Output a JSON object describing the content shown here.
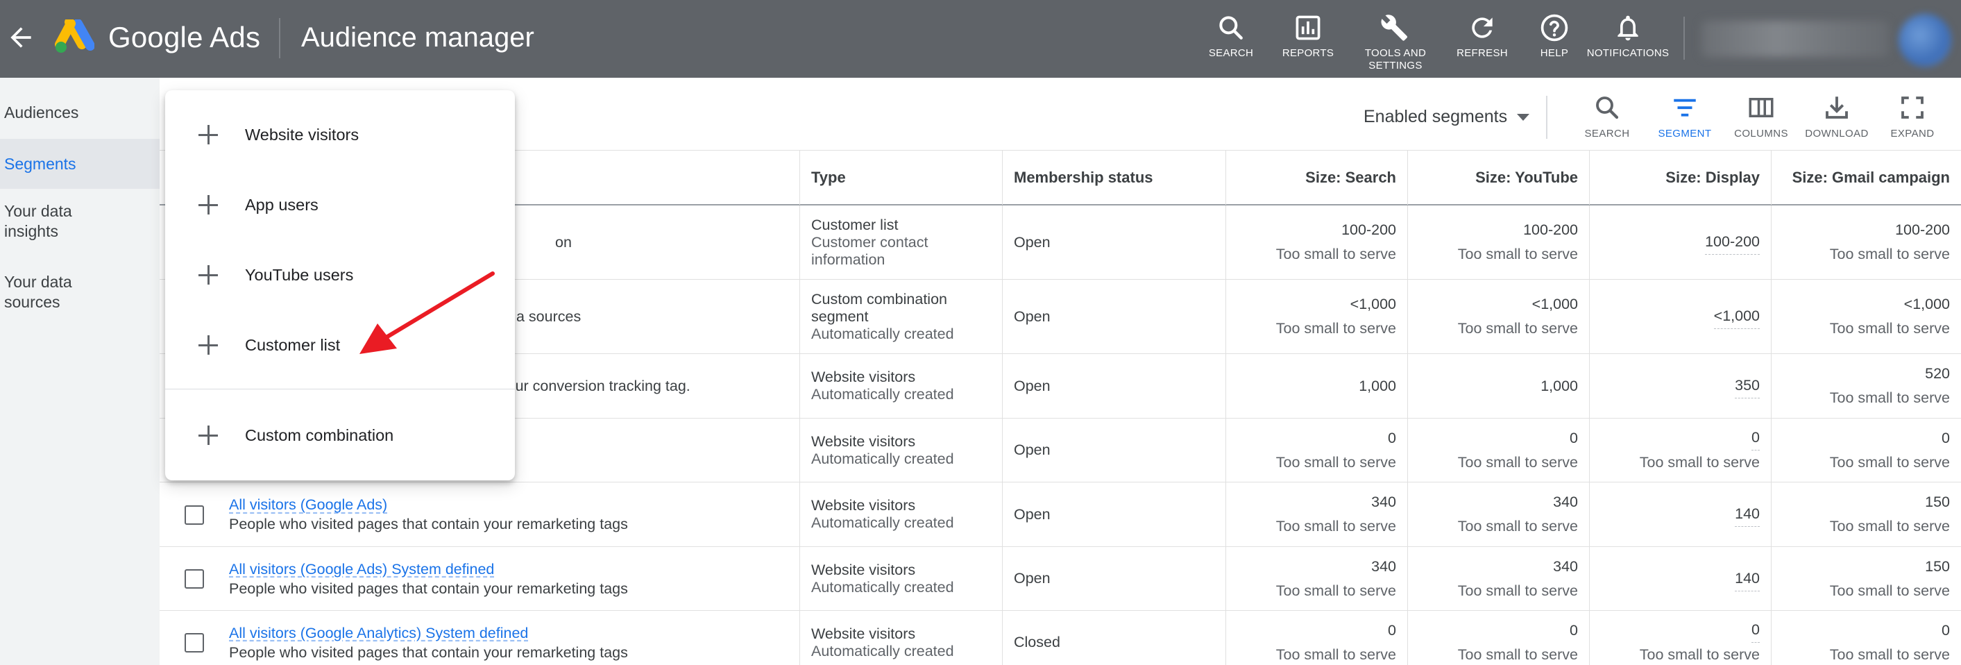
{
  "topbar": {
    "brand": "Google Ads",
    "page_title": "Audience manager",
    "actions": [
      {
        "label": "SEARCH",
        "icon": "search-icon"
      },
      {
        "label": "REPORTS",
        "icon": "reports-icon"
      },
      {
        "label": "TOOLS AND\nSETTINGS",
        "icon": "wrench-icon"
      },
      {
        "label": "REFRESH",
        "icon": "refresh-icon"
      },
      {
        "label": "HELP",
        "icon": "help-icon"
      },
      {
        "label": "NOTIFICATIONS",
        "icon": "bell-icon"
      }
    ]
  },
  "sidebar": {
    "items": [
      {
        "label": "Audiences",
        "active": false
      },
      {
        "label": "Segments",
        "active": true
      },
      {
        "label": "Your data insights",
        "active": false
      },
      {
        "label": "Your data sources",
        "active": false
      }
    ]
  },
  "toolbar": {
    "filter_label": "Enabled segments",
    "tools": [
      {
        "label": "SEARCH",
        "icon": "search-icon"
      },
      {
        "label": "SEGMENT",
        "icon": "segment-icon"
      },
      {
        "label": "COLUMNS",
        "icon": "columns-icon"
      },
      {
        "label": "DOWNLOAD",
        "icon": "download-icon"
      },
      {
        "label": "EXPAND",
        "icon": "expand-icon"
      }
    ]
  },
  "menu": {
    "items": [
      {
        "label": "Website visitors"
      },
      {
        "label": "App users"
      },
      {
        "label": "YouTube users"
      },
      {
        "label": "Customer list"
      },
      {
        "label": "Custom combination"
      }
    ]
  },
  "table": {
    "headers": {
      "type": "Type",
      "membership": "Membership status",
      "size_search": "Size: Search",
      "size_youtube": "Size: YouTube",
      "size_display": "Size: Display",
      "size_gmail": "Size: Gmail campaign"
    },
    "rows": [
      {
        "name": "",
        "desc": "on",
        "type": "Customer list",
        "type_sub": "Customer contact information",
        "membership": "Open",
        "search": {
          "v": "100-200",
          "s": "Too small to serve"
        },
        "youtube": {
          "v": "100-200",
          "s": "Too small to serve"
        },
        "display": {
          "v": "100-200",
          "s": ""
        },
        "gmail": {
          "v": "100-200",
          "s": "Too small to serve"
        }
      },
      {
        "name": "",
        "desc": "a sources",
        "type": "Custom combination segment",
        "type_sub": "Automatically created",
        "membership": "Open",
        "search": {
          "v": "<1,000",
          "s": "Too small to serve"
        },
        "youtube": {
          "v": "<1,000",
          "s": "Too small to serve"
        },
        "display": {
          "v": "<1,000",
          "s": ""
        },
        "gmail": {
          "v": "<1,000",
          "s": "Too small to serve"
        }
      },
      {
        "name": "",
        "desc": "on your conversion tracking tag.",
        "type": "Website visitors",
        "type_sub": "Automatically created",
        "membership": "Open",
        "search": {
          "v": "1,000",
          "s": ""
        },
        "youtube": {
          "v": "1,000",
          "s": ""
        },
        "display": {
          "v": "350",
          "s": ""
        },
        "gmail": {
          "v": "520",
          "s": "Too small to serve"
        }
      },
      {
        "name": "",
        "desc": "",
        "type": "Website visitors",
        "type_sub": "Automatically created",
        "membership": "Open",
        "search": {
          "v": "0",
          "s": "Too small to serve"
        },
        "youtube": {
          "v": "0",
          "s": "Too small to serve"
        },
        "display": {
          "v": "0",
          "s": "Too small to serve"
        },
        "gmail": {
          "v": "0",
          "s": "Too small to serve"
        }
      },
      {
        "name": "All visitors (Google Ads)",
        "desc": "People who visited pages that contain your remarketing tags",
        "type": "Website visitors",
        "type_sub": "Automatically created",
        "membership": "Open",
        "search": {
          "v": "340",
          "s": "Too small to serve"
        },
        "youtube": {
          "v": "340",
          "s": "Too small to serve"
        },
        "display": {
          "v": "140",
          "s": ""
        },
        "gmail": {
          "v": "150",
          "s": "Too small to serve"
        }
      },
      {
        "name": "All visitors (Google Ads) System defined",
        "desc": "People who visited pages that contain your remarketing tags",
        "type": "Website visitors",
        "type_sub": "Automatically created",
        "membership": "Open",
        "search": {
          "v": "340",
          "s": "Too small to serve"
        },
        "youtube": {
          "v": "340",
          "s": "Too small to serve"
        },
        "display": {
          "v": "140",
          "s": ""
        },
        "gmail": {
          "v": "150",
          "s": "Too small to serve"
        }
      },
      {
        "name": "All visitors (Google Analytics) System defined",
        "desc": "People who visited pages that contain your remarketing tags",
        "type": "Website visitors",
        "type_sub": "Automatically created",
        "membership": "Closed",
        "search": {
          "v": "0",
          "s": "Too small to serve"
        },
        "youtube": {
          "v": "0",
          "s": "Too small to serve"
        },
        "display": {
          "v": "0",
          "s": "Too small to serve"
        },
        "gmail": {
          "v": "0",
          "s": "Too small to serve"
        }
      }
    ]
  },
  "colors": {
    "topbar_bg": "#5f6368",
    "accent": "#1a73e8",
    "annotation_arrow": "#ea1c24"
  }
}
